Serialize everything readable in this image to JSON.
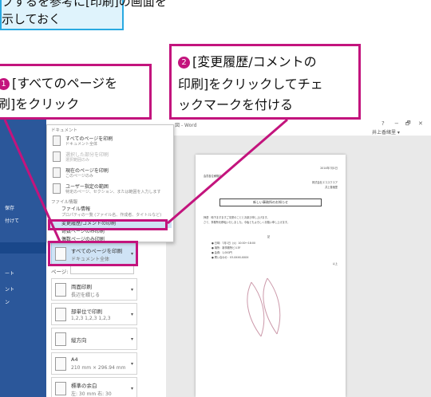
{
  "instruction_box": {
    "line1": "プするを参考に[印刷]の画面を",
    "line2": "示しておく"
  },
  "callout_1": {
    "number": "1",
    "line1": "[すべてのページを",
    "line2": "刷]をクリック"
  },
  "callout_2": {
    "number": "2",
    "line1": "[変更履歴/コメントの",
    "line2": "印刷]をクリックしてチェ",
    "line3": "ックマークを付ける"
  },
  "backstage": {
    "items": [
      "保存",
      "付けて",
      "ート",
      "ント",
      "ン"
    ]
  },
  "menu": {
    "section_document": "ドキュメント",
    "items": [
      {
        "title": "すべてのページを印刷",
        "sub": "ドキュメント全体"
      },
      {
        "title": "選択した部分を印刷",
        "sub": "選択範囲のみ"
      },
      {
        "title": "現在のページを印刷",
        "sub": "このページのみ"
      },
      {
        "title": "ユーザー指定の範囲",
        "sub": "特定のページ、セクション、または範囲を入力します"
      }
    ],
    "section_info": "ファイル情報",
    "info_title": "ファイル情報",
    "info_sub": "プロパティの一覧 (ファイル名、作成者、タイトルなど)",
    "track_changes": "変更履歴/コメントの印刷",
    "odd_pages": "奇数ページのみ印刷",
    "even_pages": "偶数ページのみ印刷"
  },
  "settings": {
    "print_all": {
      "title": "すべてのページを印刷",
      "sub": "ドキュメント全体"
    },
    "pages_label": "ページ:",
    "duplex": {
      "title": "両面印刷",
      "sub": "長辺を綴じる"
    },
    "collate": {
      "title": "部単位で印刷",
      "sub": "1,2,3   1,2,3   1,2,3"
    },
    "orientation": {
      "title": "縦方向",
      "sub": ""
    },
    "paper": {
      "title": "A4",
      "sub": "210 mm × 296.94 mm"
    },
    "margins": {
      "title": "標準の余白",
      "sub": "左: 30 mm   右: 30"
    }
  },
  "window": {
    "title": "- 図 - Word",
    "help": "?",
    "minimize": "−",
    "restore": "🗗",
    "close": "✕",
    "user": "井上香緒里 ▾"
  },
  "preview": {
    "date": "2014年7月1日",
    "recipient": "会員各位様御中",
    "sender1": "株式会社エコスクエア",
    "sender2": "井上香緒里",
    "heading": "新しい事務所のお知らせ",
    "body1": "拝啓　時下ますますご清栄のこととお慶び申し上げます。",
    "body2": "さて、事務所を移転いたしました。今後ともよろしくお願い申し上げます。",
    "note": "記",
    "item1": "● 日時：7月1日（火）10:00～18:00",
    "item2": "● 場所：新事務所ビル3F",
    "item3": "● 会費：1,000円",
    "item4": "● 問い合わせ：03-XXXX-XXXX",
    "closing": "以上"
  }
}
